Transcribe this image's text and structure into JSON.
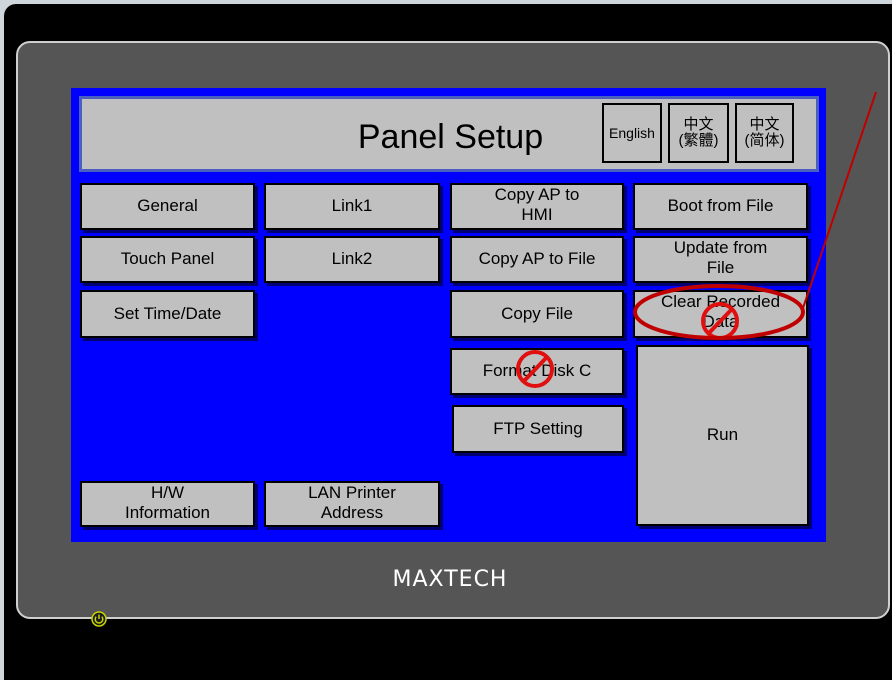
{
  "header": {
    "title": "Panel Setup"
  },
  "languages": {
    "english": "English",
    "traditional": "中文\n(繁體)",
    "simplified": "中文\n(简体)"
  },
  "buttons": {
    "general": "General",
    "link1": "Link1",
    "copy_ap_hmi_1": "Copy AP to",
    "copy_ap_hmi_2": "HMI",
    "boot_from_file": "Boot from File",
    "touch_panel": "Touch Panel",
    "link2": "Link2",
    "copy_ap_file": "Copy AP to File",
    "update_from_file_1": "Update from",
    "update_from_file_2": "File",
    "set_time_date": "Set Time/Date",
    "copy_file": "Copy File",
    "clear_recorded_1": "Clear Recorded",
    "clear_recorded_2": "Data",
    "format_disk_c": "Format Disk C",
    "ftp_setting": "FTP Setting",
    "run": "Run",
    "hw_info_1": "H/W",
    "hw_info_2": "Information",
    "lan_printer_1": "LAN Printer",
    "lan_printer_2": "Address"
  },
  "brand": {
    "logo": "MAXTECH"
  },
  "colors": {
    "screen": "#0000ff",
    "button": "#c0c0c0",
    "bezel": "#555555",
    "highlight": "#cc0000"
  },
  "icons": {
    "prohibited": "no-entry-icon",
    "power": "power-icon"
  }
}
